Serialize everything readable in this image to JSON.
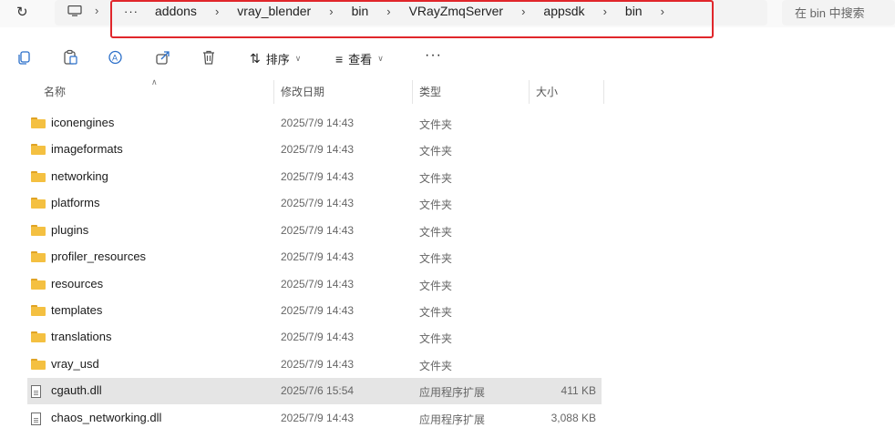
{
  "nav": {
    "refresh_icon": "refresh-icon",
    "breadcrumb": {
      "overflow": "···",
      "items": [
        "addons",
        "vray_blender",
        "bin",
        "VRayZmqServer",
        "appsdk",
        "bin"
      ]
    },
    "search_placeholder": "在 bin 中搜索"
  },
  "toolbar": {
    "sort_label": "排序",
    "view_label": "查看",
    "more_label": "···"
  },
  "columns": {
    "name": "名称",
    "date": "修改日期",
    "type": "类型",
    "size": "大小"
  },
  "files": [
    {
      "name": "iconengines",
      "date": "2025/7/9 14:43",
      "type": "文件夹",
      "size": "",
      "kind": "folder"
    },
    {
      "name": "imageformats",
      "date": "2025/7/9 14:43",
      "type": "文件夹",
      "size": "",
      "kind": "folder"
    },
    {
      "name": "networking",
      "date": "2025/7/9 14:43",
      "type": "文件夹",
      "size": "",
      "kind": "folder"
    },
    {
      "name": "platforms",
      "date": "2025/7/9 14:43",
      "type": "文件夹",
      "size": "",
      "kind": "folder"
    },
    {
      "name": "plugins",
      "date": "2025/7/9 14:43",
      "type": "文件夹",
      "size": "",
      "kind": "folder"
    },
    {
      "name": "profiler_resources",
      "date": "2025/7/9 14:43",
      "type": "文件夹",
      "size": "",
      "kind": "folder"
    },
    {
      "name": "resources",
      "date": "2025/7/9 14:43",
      "type": "文件夹",
      "size": "",
      "kind": "folder"
    },
    {
      "name": "templates",
      "date": "2025/7/9 14:43",
      "type": "文件夹",
      "size": "",
      "kind": "folder"
    },
    {
      "name": "translations",
      "date": "2025/7/9 14:43",
      "type": "文件夹",
      "size": "",
      "kind": "folder"
    },
    {
      "name": "vray_usd",
      "date": "2025/7/9 14:43",
      "type": "文件夹",
      "size": "",
      "kind": "folder"
    },
    {
      "name": "cgauth.dll",
      "date": "2025/7/6 15:54",
      "type": "应用程序扩展",
      "size": "411 KB",
      "kind": "file",
      "selected": true
    },
    {
      "name": "chaos_networking.dll",
      "date": "2025/7/9 14:43",
      "type": "应用程序扩展",
      "size": "3,088 KB",
      "kind": "file"
    }
  ],
  "colors": {
    "highlight_border": "#e0262b",
    "selected_row": "#e5e5e5",
    "folder": "#f4c041"
  }
}
